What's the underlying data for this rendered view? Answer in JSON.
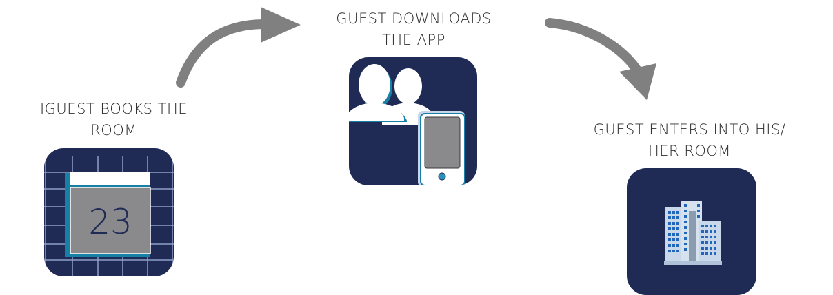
{
  "steps": [
    {
      "label_lines": [
        "IGUEST BOOKS THE",
        "ROOM"
      ],
      "icon": "calendar-icon"
    },
    {
      "label_lines": [
        "GUEST DOWNLOADS",
        "THE APP"
      ],
      "icon": "guests-with-phone-icon"
    },
    {
      "label_lines": [
        "GUEST ENTERS INTO HIS/",
        "HER ROOM"
      ],
      "icon": "hotel-building-icon"
    }
  ],
  "calendar": {
    "day": "23"
  },
  "colors": {
    "tile_background": "#1f2a55",
    "arrow": "#808080",
    "accent_teal": "#1780a6",
    "gray_screen": "#8a8a8d",
    "building_blue": "#2166b8",
    "label_text": "#2f2f2f"
  }
}
